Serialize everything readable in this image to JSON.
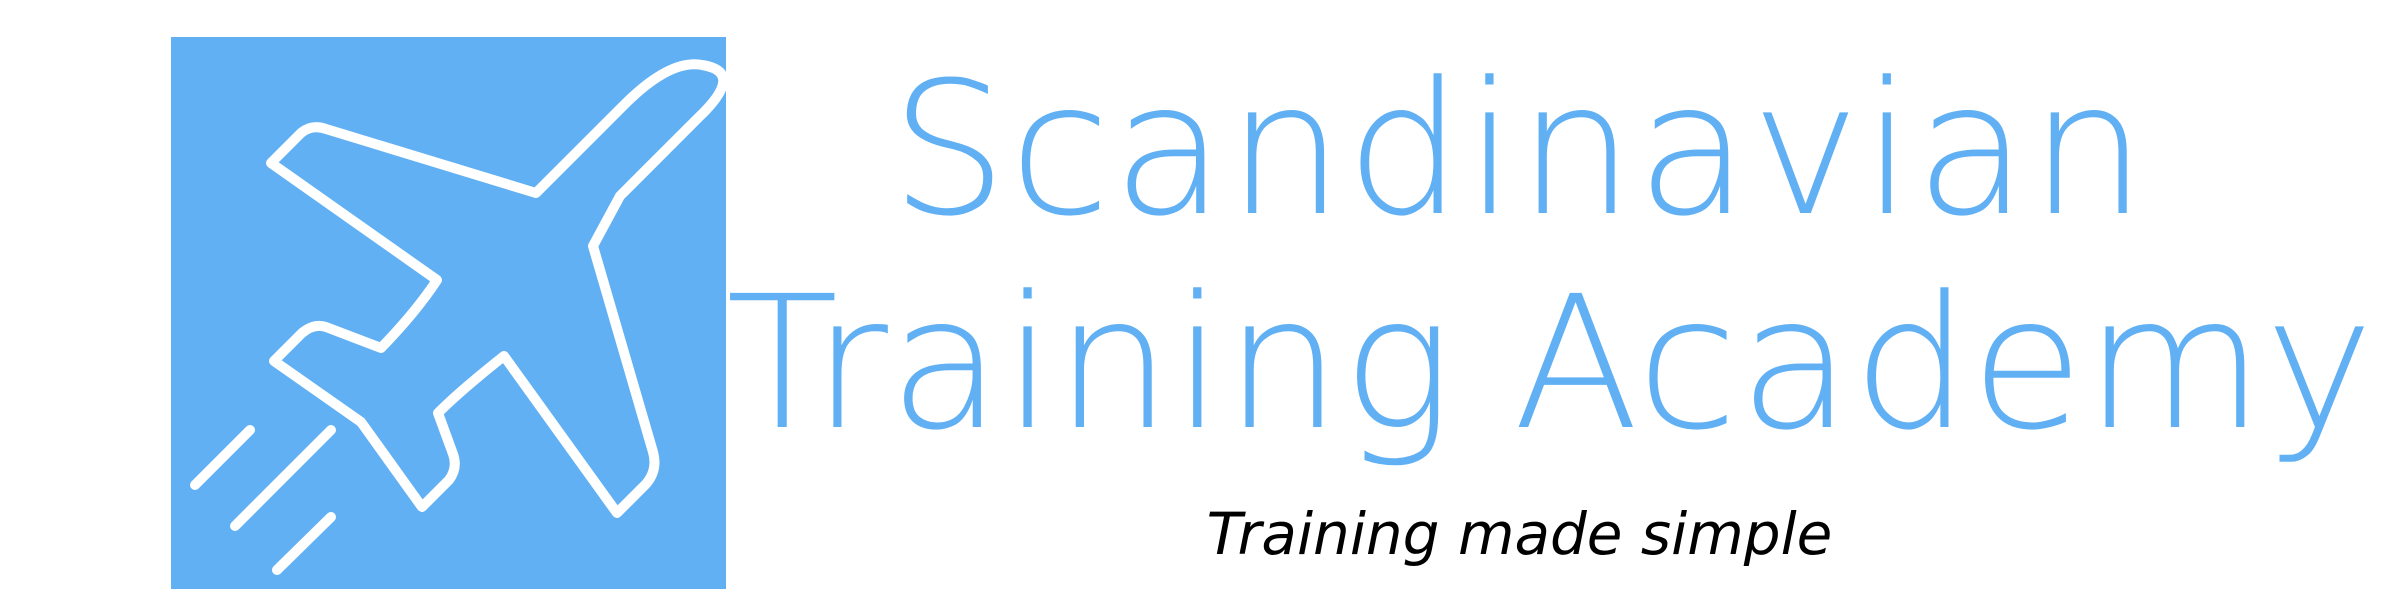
{
  "logo": {
    "icon": "airplane-icon",
    "background_color": "#61b0f4",
    "icon_color": "#ffffff"
  },
  "brand": {
    "line1": "Scandinavian",
    "line2": "Training Academy",
    "color": "#61b0f4"
  },
  "tagline": {
    "text": "Training made simple",
    "color": "#000000"
  }
}
